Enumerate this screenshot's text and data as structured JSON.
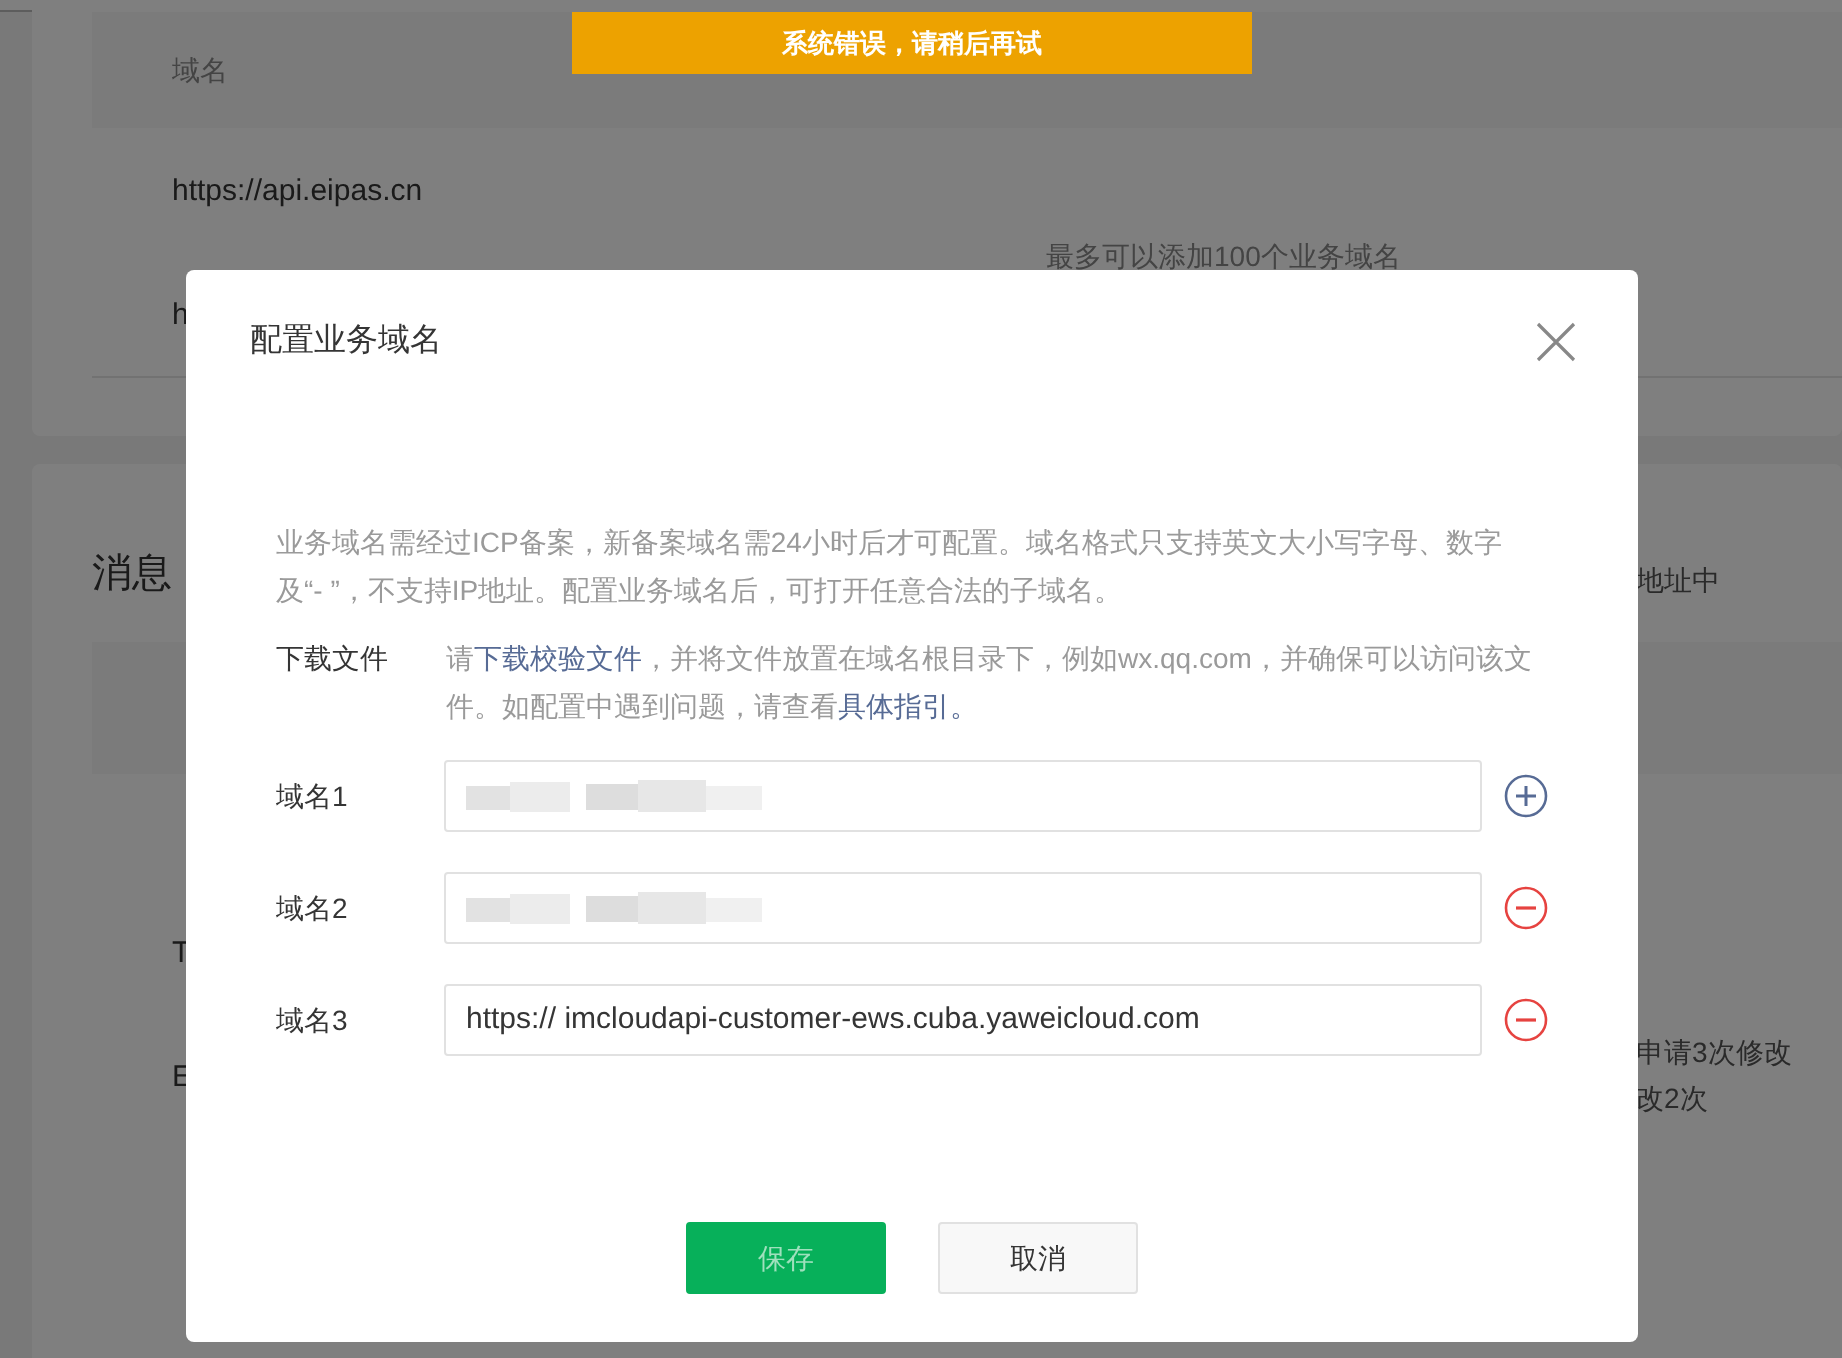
{
  "toast": {
    "text": "系统错误，请稍后再试"
  },
  "background": {
    "table_header": "域名",
    "rows": [
      "https://api.eipas.cn",
      "h"
    ],
    "note": "最多可以添加100个业务域名",
    "section_title": "消息",
    "right_texts": [
      "地址中",
      "申请3次修改",
      "改2次"
    ],
    "list_items": [
      "T",
      "E"
    ]
  },
  "dialog": {
    "title": "配置业务域名",
    "description": "业务域名需经过ICP备案，新备案域名需24小时后才可配置。域名格式只支持英文大小写字母、数字及“- ”，不支持IP地址。配置业务域名后，可打开任意合法的子域名。",
    "download": {
      "label": "下载文件",
      "parts": [
        {
          "kind": "text",
          "text": "请"
        },
        {
          "kind": "link",
          "text": "下载校验文件"
        },
        {
          "kind": "text",
          "text": "，并将文件放置在域名根目录下，例如wx.qq.com，并确保可以访问该文件。如配置中遇到问题，请查看"
        },
        {
          "kind": "link",
          "text": "具体指引。"
        }
      ]
    },
    "domains": [
      {
        "label": "域名1",
        "redacted": true,
        "kind": "add"
      },
      {
        "label": "域名2",
        "redacted": true,
        "kind": "remove"
      },
      {
        "label": "域名3",
        "redacted": false,
        "value": "https:// imcloudapi-customer-ews.cuba.yaweicloud.com",
        "kind": "remove"
      }
    ],
    "buttons": [
      {
        "label": "保存",
        "kind": "primary",
        "disabled": true
      },
      {
        "label": "取消",
        "kind": "secondary",
        "disabled": false
      }
    ]
  }
}
